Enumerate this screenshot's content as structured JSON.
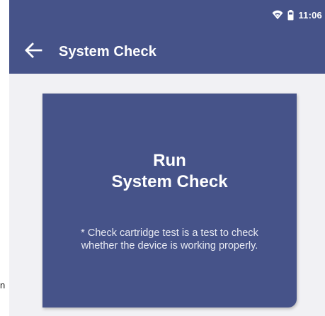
{
  "status_bar": {
    "time": "11:06",
    "icons": [
      "wifi-icon",
      "battery-icon"
    ]
  },
  "header": {
    "title": "System Check",
    "back_icon": "arrow-left-icon"
  },
  "run_card": {
    "title_line1": "Run",
    "title_line2": "System Check",
    "note_line1": "* Check cartridge test is a test to check",
    "note_line2": "whether the device is working properly."
  },
  "edge_fragment": "n",
  "colors": {
    "primary": "#465389",
    "background": "#f1f1f4",
    "text_on_primary": "#ffffff"
  }
}
